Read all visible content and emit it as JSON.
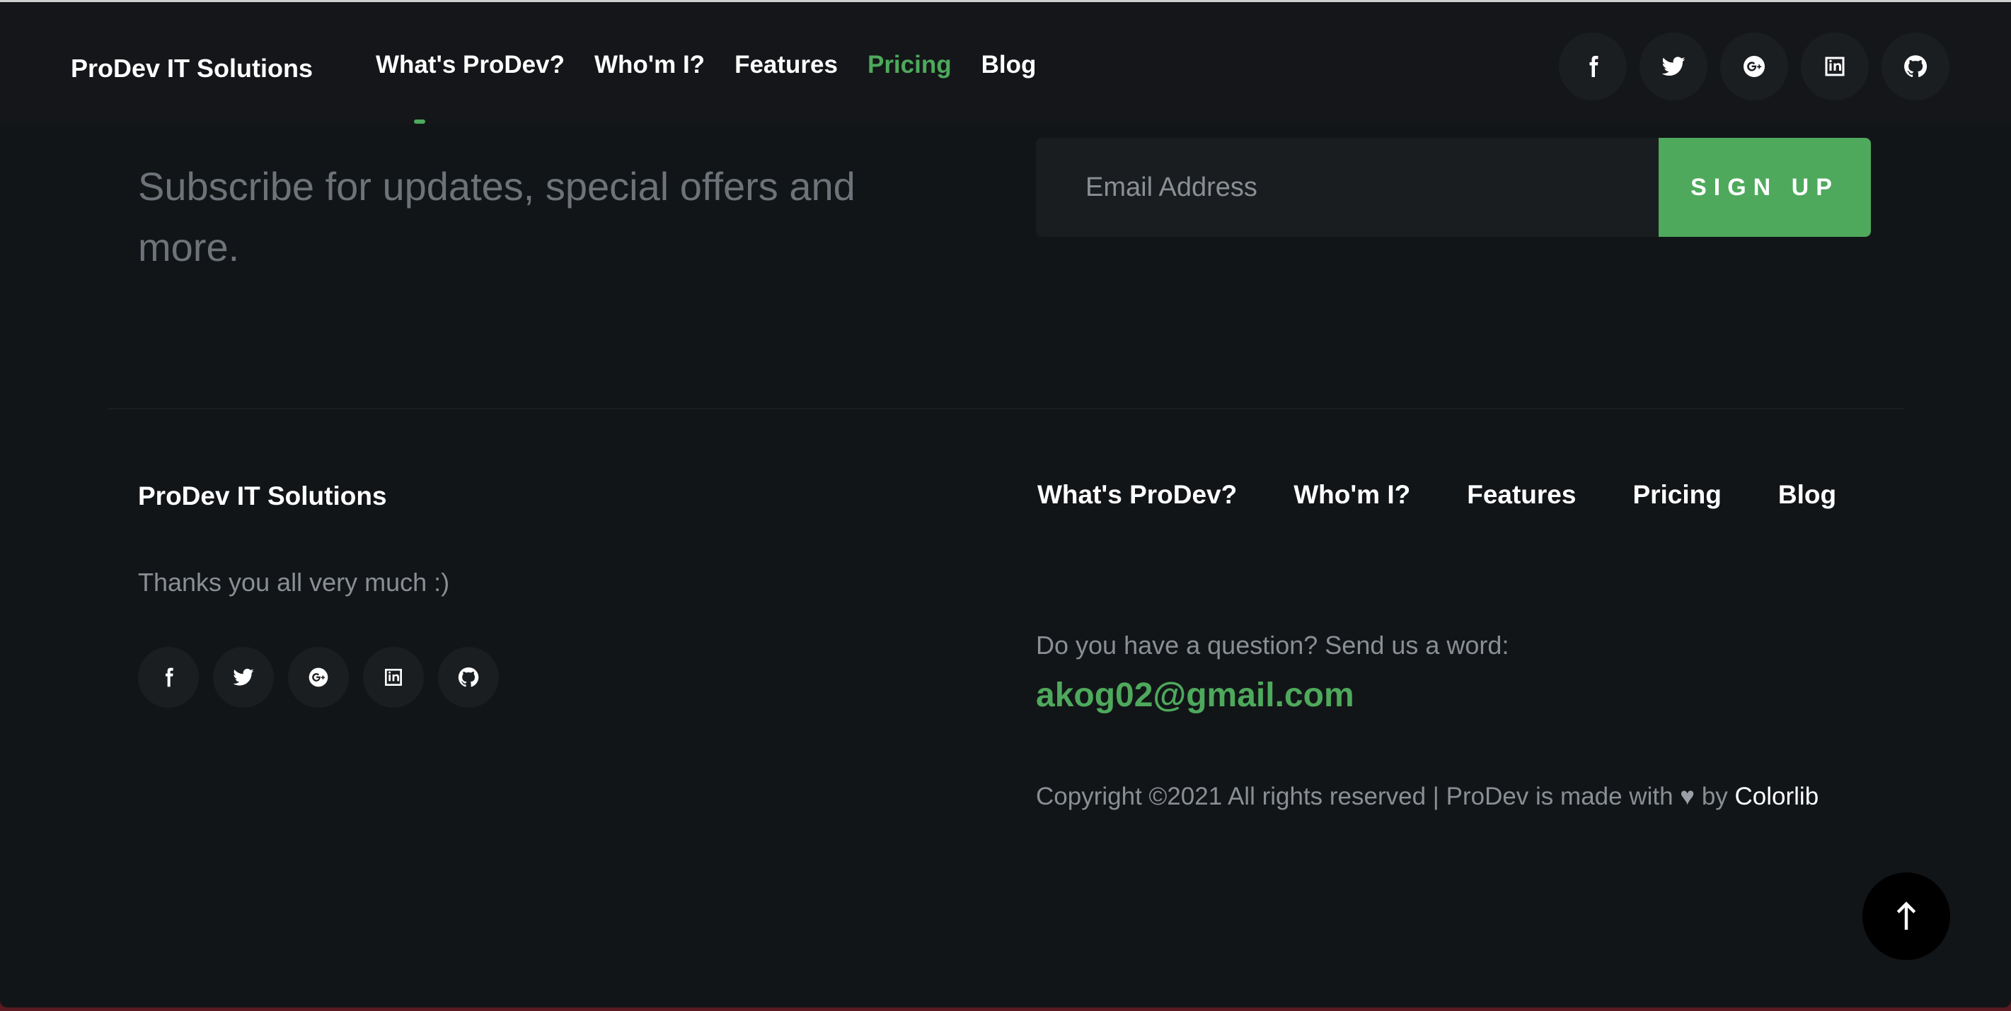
{
  "header": {
    "brand": "ProDev IT Solutions",
    "nav": [
      "What's ProDev?",
      "Who'm I?",
      "Features",
      "Pricing",
      "Blog"
    ],
    "active_nav": "Pricing",
    "social_icons": [
      "facebook-icon",
      "twitter-icon",
      "google-plus-icon",
      "linkedin-icon",
      "github-icon"
    ]
  },
  "subscribe": {
    "text": "Subscribe for updates, special offers and more.",
    "email_placeholder": "Email Address",
    "button_label": "SIGN UP"
  },
  "footer": {
    "brand": "ProDev IT Solutions",
    "thanks": "Thanks you all very much :)",
    "social_icons": [
      "facebook-icon",
      "twitter-icon",
      "google-plus-icon",
      "linkedin-icon",
      "github-icon"
    ],
    "nav": [
      "What's ProDev?",
      "Who'm I?",
      "Features",
      "Pricing",
      "Blog"
    ],
    "question": "Do you have a question? Send us a word:",
    "email": "akog02@gmail.com",
    "copyright_prefix": "Copyright ©2021 All rights reserved | ProDev is made with",
    "heart": "♥",
    "copyright_by": "by",
    "copyright_link": "Colorlib"
  },
  "colors": {
    "accent": "#4ea95c",
    "background": "#121518",
    "muted_text": "#8a8f93"
  },
  "back_to_top_icon": "arrow-up-icon"
}
